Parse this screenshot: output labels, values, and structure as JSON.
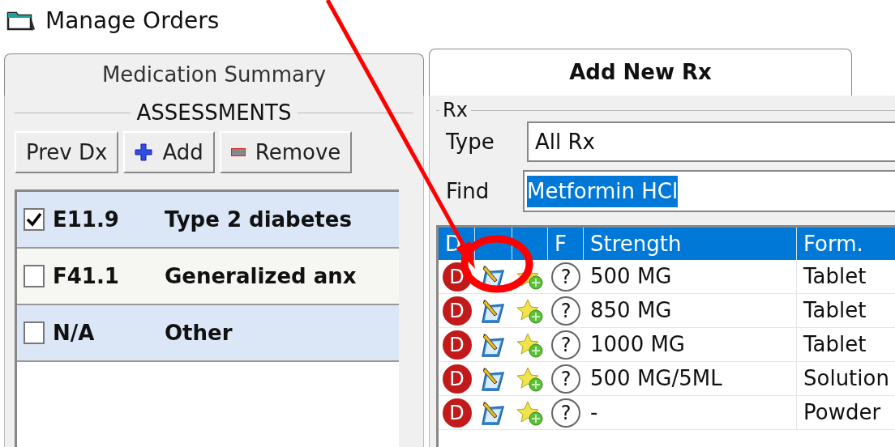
{
  "window": {
    "title": "Manage Orders"
  },
  "tabs": [
    {
      "label": "Medication Summary",
      "selected": false
    },
    {
      "label": "Add New Rx",
      "selected": true
    }
  ],
  "assessments": {
    "title": "ASSESSMENTS",
    "buttons": [
      {
        "label": "Prev Dx",
        "kind": "plain"
      },
      {
        "label": "Add",
        "kind": "add"
      },
      {
        "label": "Remove",
        "kind": "remove"
      }
    ],
    "items": [
      {
        "code": "E11.9",
        "description": "Type 2 diabetes",
        "checked": true
      },
      {
        "code": "F41.1",
        "description": "Generalized anx",
        "checked": false
      },
      {
        "code": "N/A",
        "description": "Other",
        "checked": false
      }
    ]
  },
  "rx": {
    "title": "Rx",
    "type": {
      "label": "Type",
      "value": "All Rx"
    },
    "find": {
      "label": "Find",
      "value": "Metformin HCl"
    },
    "table": {
      "columns": [
        "D",
        "",
        "",
        "F",
        "Strength",
        "Form."
      ],
      "rows": [
        {
          "badge": "D",
          "help": "?",
          "strength": "500 MG",
          "form": "Tablet"
        },
        {
          "badge": "D",
          "help": "?",
          "strength": "850 MG",
          "form": "Tablet"
        },
        {
          "badge": "D",
          "help": "?",
          "strength": "1000 MG",
          "form": "Tablet"
        },
        {
          "badge": "D",
          "help": "?",
          "strength": "500 MG/5ML",
          "form": "Solution"
        },
        {
          "badge": "D",
          "help": "?",
          "strength": "-",
          "form": "Powder"
        }
      ]
    }
  }
}
